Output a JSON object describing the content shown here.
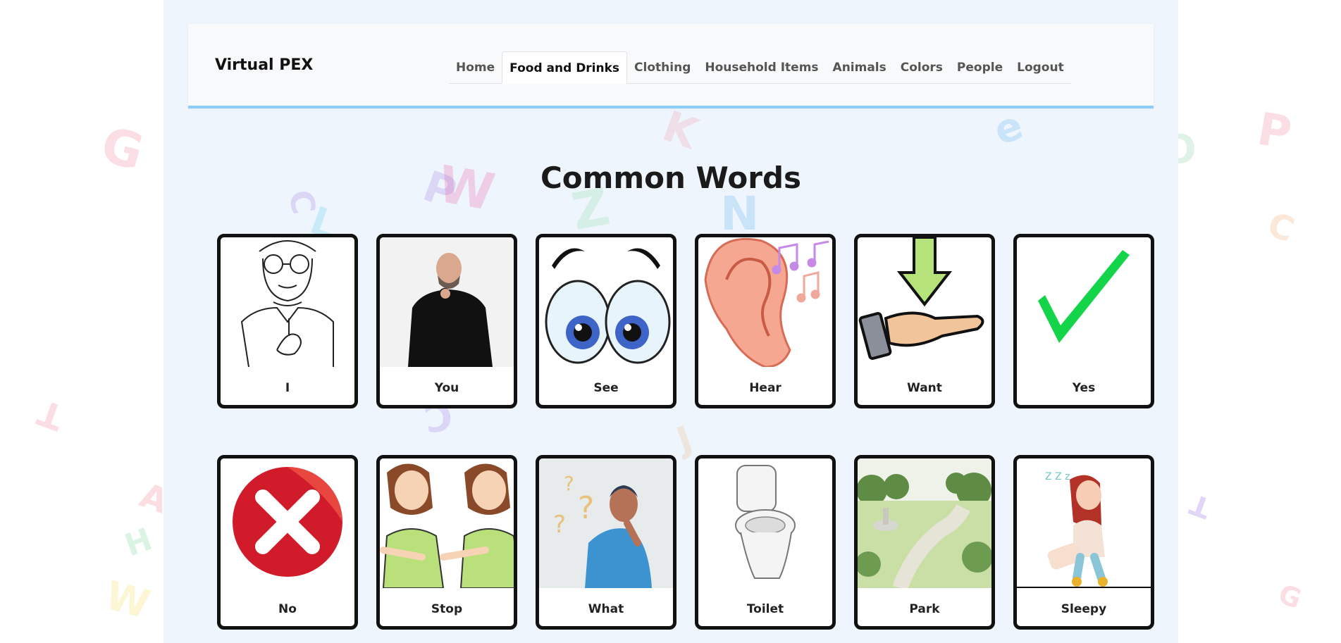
{
  "nav": {
    "brand": "Virtual PEX",
    "items": [
      {
        "label": "Home"
      },
      {
        "label": "Food and Drinks",
        "active": true
      },
      {
        "label": "Clothing"
      },
      {
        "label": "Household Items"
      },
      {
        "label": "Animals"
      },
      {
        "label": "Colors"
      },
      {
        "label": "People"
      },
      {
        "label": "Logout"
      }
    ]
  },
  "main": {
    "heading": "Common Words",
    "cards": [
      {
        "label": "I",
        "icon": "boy-pointing-self-icon"
      },
      {
        "label": "You",
        "icon": "man-pointing-icon"
      },
      {
        "label": "See",
        "icon": "eyes-icon"
      },
      {
        "label": "Hear",
        "icon": "ear-music-icon"
      },
      {
        "label": "Want",
        "icon": "hand-receive-arrow-icon"
      },
      {
        "label": "Yes",
        "icon": "checkmark-icon"
      },
      {
        "label": "No",
        "icon": "red-x-icon"
      },
      {
        "label": "Stop",
        "icon": "stop-sign-language-icon"
      },
      {
        "label": "What",
        "icon": "question-person-icon"
      },
      {
        "label": "Toilet",
        "icon": "toilet-icon"
      },
      {
        "label": "Park",
        "icon": "park-icon"
      },
      {
        "label": "Sleepy",
        "icon": "sleepy-girl-icon"
      }
    ]
  },
  "colors": {
    "panel_bg": "#eef5fd",
    "navbar_accent": "#8ccdf8",
    "card_border": "#111111"
  }
}
